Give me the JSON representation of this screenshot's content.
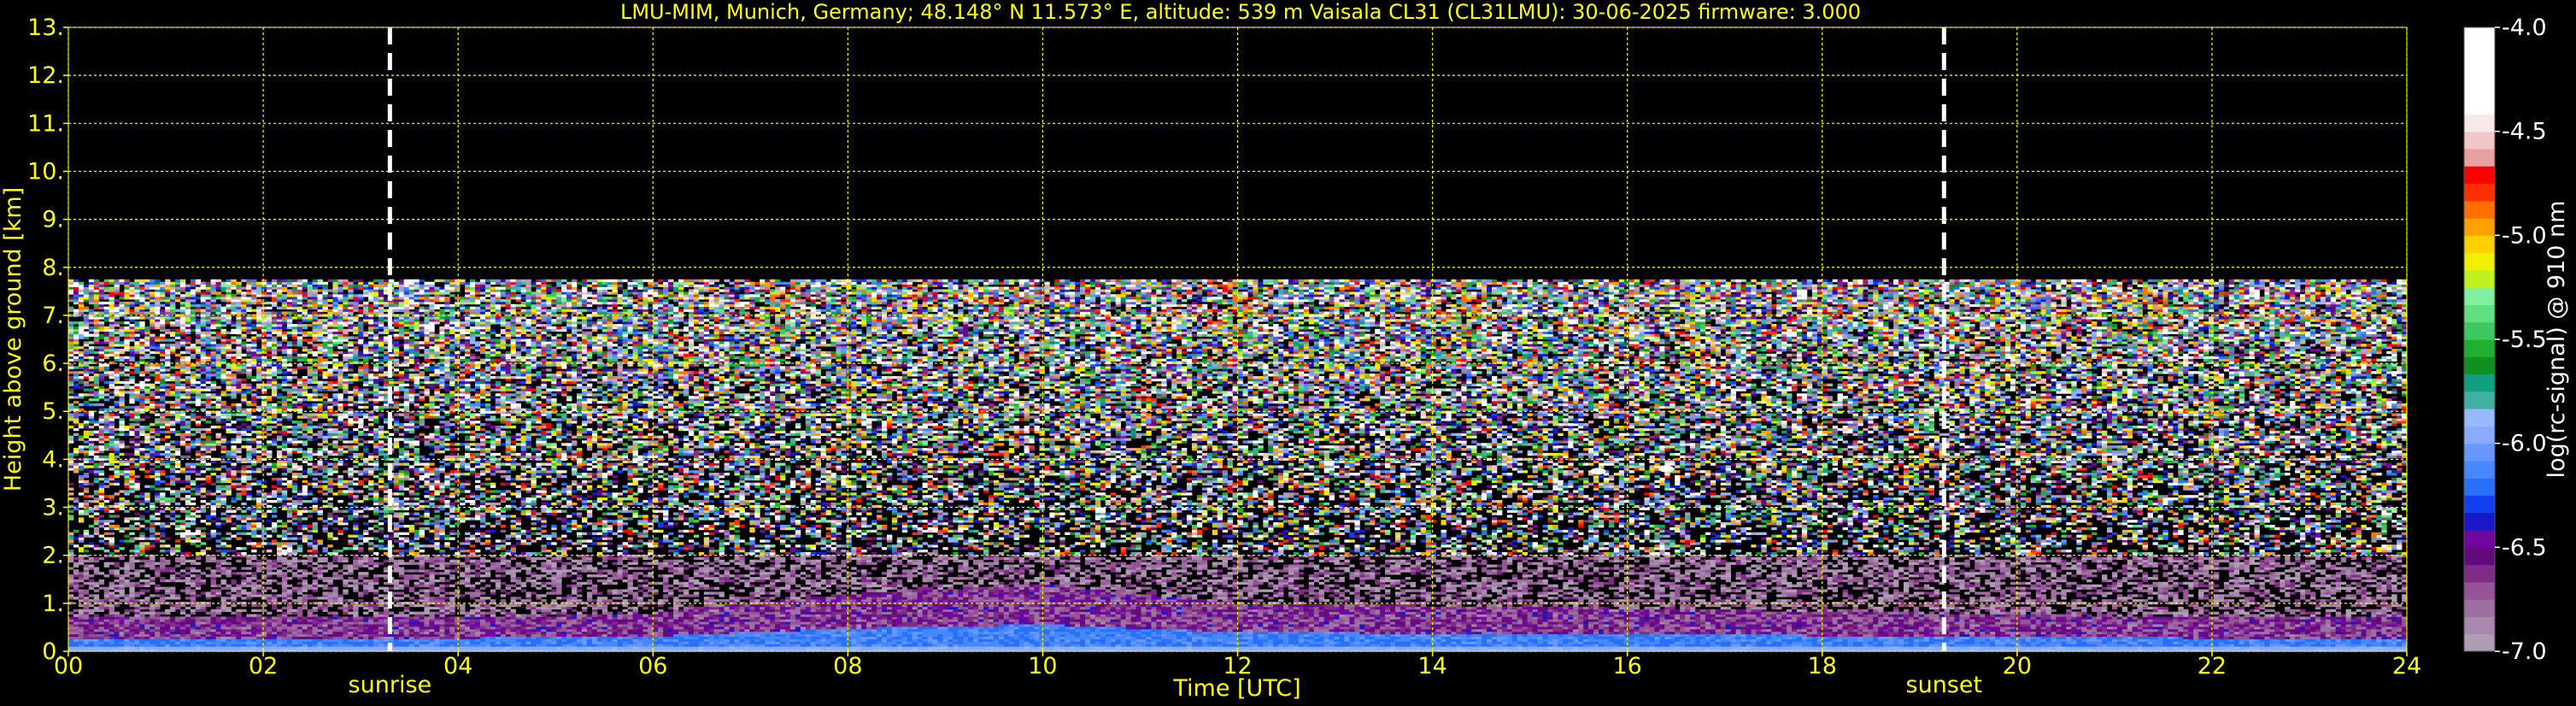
{
  "colors": {
    "background": "#000000",
    "text": "#ffff00",
    "grid": "#ffff00",
    "sun_lines": "#ffffff",
    "colorbar_text": "#ffffff"
  },
  "chart_data": {
    "type": "heatmap",
    "title": "LMU-MIM, Munich, Germany; 48.148° N 11.573° E, altitude: 539 m    Vaisala CL31 (CL31LMU): 30-06-2025    firmware: 3.000",
    "xlabel": "Time [UTC]",
    "ylabel": "Height above ground [km]",
    "xlim": [
      0,
      24
    ],
    "ylim": [
      0,
      13
    ],
    "x_ticks": [
      0,
      2,
      4,
      6,
      8,
      10,
      12,
      14,
      16,
      18,
      20,
      22,
      24
    ],
    "x_tick_labels": [
      "00",
      "02",
      "04",
      "06",
      "08",
      "10",
      "12",
      "14",
      "16",
      "18",
      "20",
      "22",
      "24"
    ],
    "y_ticks": [
      0,
      1,
      2,
      3,
      4,
      5,
      6,
      7,
      8,
      9,
      10,
      11,
      12,
      13
    ],
    "y_tick_labels": [
      "0.",
      "1.",
      "2.",
      "3.",
      "4.",
      "5.",
      "6.",
      "7.",
      "8.",
      "9.",
      "10.",
      "11.",
      "12.",
      "13."
    ],
    "grid": true,
    "signal_top_km": 7.75,
    "markers": [
      {
        "label": "sunrise",
        "time": 3.3
      },
      {
        "label": "sunset",
        "time": 19.25
      }
    ],
    "colorbar": {
      "label": "log(rc-signal) @ 910 nm",
      "range": [
        -7.0,
        -4.0
      ],
      "ticks": [
        -7.0,
        -6.5,
        -6.0,
        -5.5,
        -5.0,
        -4.5,
        -4.0
      ],
      "tick_labels": [
        "-7.0",
        "-6.5",
        "-6.0",
        "-5.5",
        "-5.0",
        "-4.5",
        "-4.0"
      ],
      "colors": [
        "#b09cb4",
        "#a888ac",
        "#9e70a2",
        "#945496",
        "#7e2c86",
        "#640a7a",
        "#7008a0",
        "#1818c8",
        "#1040f0",
        "#2870f8",
        "#4888ff",
        "#6898ff",
        "#88aaff",
        "#98b8ff",
        "#40b0a0",
        "#10a080",
        "#109020",
        "#20b030",
        "#40c860",
        "#60e080",
        "#80f0a0",
        "#c0f020",
        "#f0f000",
        "#ffd000",
        "#ffa000",
        "#ff7000",
        "#ff3000",
        "#ff0000",
        "#e8a0a0",
        "#f0c8c8",
        "#f8e8e8",
        "#ffffff",
        "#ffffff",
        "#ffffff",
        "#ffffff",
        "#ffffff"
      ]
    },
    "features": [
      {
        "type": "boundary_layer",
        "height_km_by_time": {
          "times": [
            0,
            4,
            6,
            8,
            9,
            10,
            11,
            12,
            16,
            19,
            22,
            24
          ],
          "heights": [
            0.7,
            0.7,
            0.8,
            1.2,
            1.3,
            1.4,
            1.2,
            1.0,
            0.9,
            0.8,
            0.7,
            0.7
          ]
        }
      },
      {
        "type": "cloud_points",
        "points": [
          [
            15.7,
            3.75
          ],
          [
            16.4,
            3.8
          ]
        ]
      }
    ]
  }
}
